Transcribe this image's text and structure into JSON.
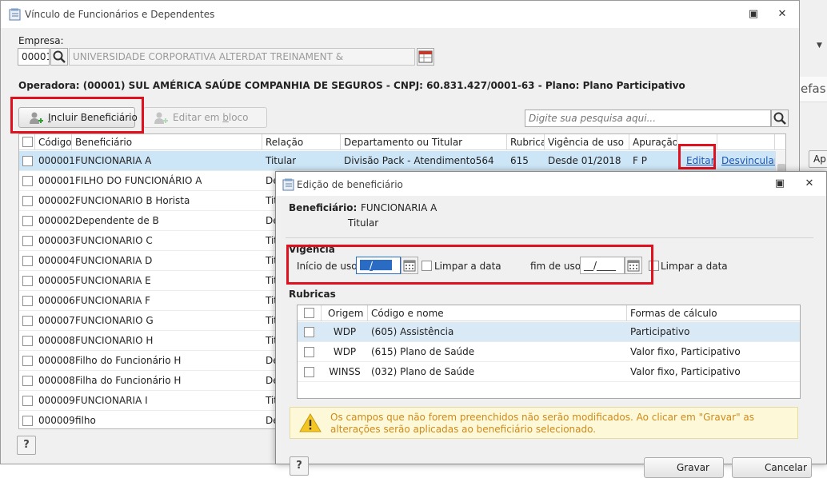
{
  "main_window": {
    "title": "Vínculo de Funcionários e Dependentes",
    "empresa_label": "Empresa:",
    "empresa_code": "00001",
    "empresa_name": "UNIVERSIDADE CORPORATIVA ALTERDAT TREINAMENT &",
    "operadora_text": "Operadora: (00001) SUL AMÉRICA SAÚDE COMPANHIA DE SEGUROS - CNPJ: 60.831.427/0001-63 - Plano: Plano Participativo",
    "include_button": "Incluir Beneficiário",
    "include_button_underline": "I",
    "include_button_rest": "ncluir Beneficiário",
    "edit_bulk_button": "Editar em bloco",
    "edit_bulk_prefix": "Editar em ",
    "edit_bulk_underline": "b",
    "edit_bulk_rest": "loco",
    "search_placeholder": "Digite sua pesquisa aqui...",
    "columns": [
      "Código",
      "Beneficiário",
      "Relação",
      "Departamento ou Titular",
      "Rubrica",
      "Vigência de uso",
      "Apuração"
    ],
    "rows": [
      {
        "codigo": "000001",
        "beneficiario": "FUNCIONARIA A",
        "relacao": "Titular",
        "departamento": "Divisão Pack - Atendimento564",
        "rubrica": "615",
        "vigencia": "Desde 01/2018",
        "apuracao": "F P",
        "edit": "Editar",
        "unlink": "Desvincular"
      },
      {
        "codigo": "000001",
        "beneficiario": "FILHO DO FUNCIONÁRIO A",
        "relacao": "De"
      },
      {
        "codigo": "000002",
        "beneficiario": "FUNCIONARIO  B Horista",
        "relacao": "Tit"
      },
      {
        "codigo": "000002",
        "beneficiario": "Dependente de B",
        "relacao": "De"
      },
      {
        "codigo": "000003",
        "beneficiario": "FUNCIONARIO C",
        "relacao": "Tit"
      },
      {
        "codigo": "000004",
        "beneficiario": "FUNCIONARIA D",
        "relacao": "Tit"
      },
      {
        "codigo": "000005",
        "beneficiario": "FUNCIONARIA E",
        "relacao": "Tit"
      },
      {
        "codigo": "000006",
        "beneficiario": "FUNCIONARIA F",
        "relacao": "Tit"
      },
      {
        "codigo": "000007",
        "beneficiario": "FUNCIONARIO G",
        "relacao": "Tit"
      },
      {
        "codigo": "000008",
        "beneficiario": "FUNCIONARIO H",
        "relacao": "Tit"
      },
      {
        "codigo": "000008",
        "beneficiario": "Filho do Funcionário H",
        "relacao": "De"
      },
      {
        "codigo": "000008",
        "beneficiario": "Filha do Funcionário H",
        "relacao": "De"
      },
      {
        "codigo": "000009",
        "beneficiario": "FUNCIONARIA I",
        "relacao": "Tit"
      },
      {
        "codigo": "000009",
        "beneficiario": "filho",
        "relacao": "De"
      }
    ],
    "help_label": "?"
  },
  "background": {
    "edge_tab": "efas",
    "edge_button": "Ap"
  },
  "dialog": {
    "title": "Edição de beneficiário",
    "beneficiario_label": "Beneficiário:",
    "beneficiario_name": "FUNCIONARIA A",
    "relacao": "Titular",
    "vigencia_label": "Vigência",
    "inicio_label": "Início de uso:",
    "inicio_value": "__/____",
    "limpar_label": "Limpar a data",
    "fim_label": "fim de uso:",
    "fim_value": "__/____",
    "rubricas_label": "Rubricas",
    "sub_columns": [
      "Origem",
      "Código e nome",
      "Formas de cálculo"
    ],
    "sub_rows": [
      {
        "origem": "WDP",
        "codigo_nome": "(605) Assistência",
        "formas": "Participativo"
      },
      {
        "origem": "WDP",
        "codigo_nome": "(615) Plano de Saúde",
        "formas": "Valor fixo, Participativo"
      },
      {
        "origem": "WINSS",
        "codigo_nome": "(032) Plano de Saúde",
        "formas": "Valor fixo, Participativo"
      }
    ],
    "warning": "Os campos que não forem preenchidos não serão modificados. Ao clicar em \"Gravar\" as alterações serão aplicadas ao beneficiário selecionado.",
    "help_label": "?",
    "gravar_label": "Gravar",
    "cancelar_label": "Cancelar"
  },
  "colors": {
    "highlight": "#e0111e",
    "selected_row": "#cde6f7",
    "link": "#1a55b8",
    "warning_text": "#d08a19"
  }
}
